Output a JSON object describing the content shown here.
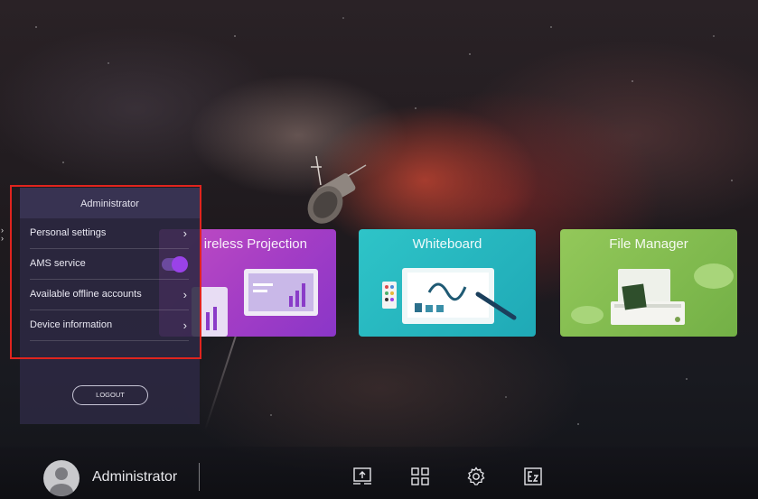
{
  "tiles": [
    {
      "title": "ireless Projection",
      "color": "#b243c4"
    },
    {
      "title": "Whiteboard",
      "color": "#24b5bf"
    },
    {
      "title": "File Manager",
      "color": "#83bc50"
    }
  ],
  "panel": {
    "header": "Administrator",
    "items": [
      {
        "label": "Personal settings",
        "control": "chevron"
      },
      {
        "label": "AMS service",
        "control": "toggle",
        "toggle_on": true
      },
      {
        "label": "Available offline accounts",
        "control": "chevron"
      },
      {
        "label": "Device information",
        "control": "chevron"
      }
    ],
    "logout_label": "LOGOUT",
    "accent": "#9a42e8",
    "highlight_border": "#e0241e"
  },
  "taskbar": {
    "user_name": "Administrator",
    "icons": [
      "screen-share-icon",
      "apps-grid-icon",
      "settings-gear-icon",
      "ez-write-icon"
    ]
  }
}
